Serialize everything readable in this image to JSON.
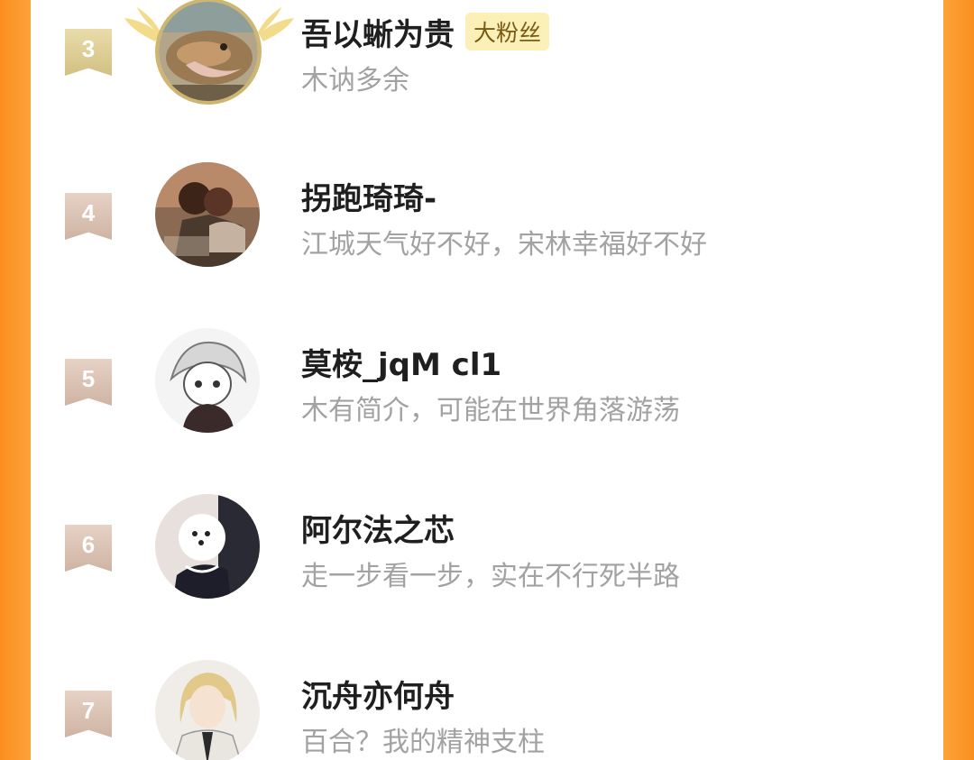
{
  "fans": [
    {
      "rank": "3",
      "name": "吾以蜥为贵",
      "badge": "大粉丝",
      "bio": "木讷多余",
      "rank_color": "#d9c88e",
      "avatar": "lizard-photo"
    },
    {
      "rank": "4",
      "name": "拐跑琦琦-",
      "badge": "",
      "bio": "江城天气好不好，宋林幸福好不好",
      "rank_color": "#d9bfb0",
      "avatar": "illustrated-couple"
    },
    {
      "rank": "5",
      "name": "莫桉_jqM cl1",
      "badge": "",
      "bio": "木有简介，可能在世界角落游荡",
      "rank_color": "#d9bfb0",
      "avatar": "anime-sketch"
    },
    {
      "rank": "6",
      "name": "阿尔法之芯",
      "badge": "",
      "bio": "走一步看一步，实在不行死半路",
      "rank_color": "#d9bfb0",
      "avatar": "white-dog"
    },
    {
      "rank": "7",
      "name": "沉舟亦何舟",
      "badge": "",
      "bio": "百合？我的精神支柱",
      "rank_color": "#d9bfb0",
      "avatar": "anime-blonde-man"
    }
  ],
  "colors": {
    "side_orange": "#fb8f1f",
    "name": "#1f1f1f",
    "bio": "#a2a2a2",
    "badge_bg": "#fbf0b8",
    "badge_text": "#7a5a14"
  }
}
